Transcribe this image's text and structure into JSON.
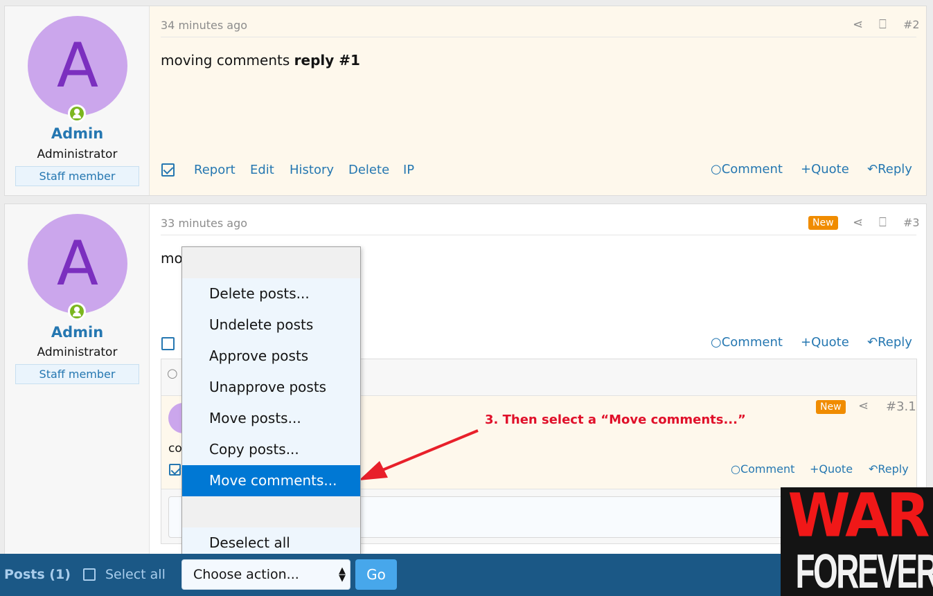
{
  "posts": [
    {
      "avatar_letter": "A",
      "username": "Admin",
      "user_title": "Administrator",
      "banner": "Staff member",
      "time": "34 minutes ago",
      "number": "#2",
      "content_plain": "moving comments ",
      "content_bold": "reply #1",
      "actions": [
        "Report",
        "Edit",
        "History",
        "Delete",
        "IP"
      ],
      "right_actions": [
        "Comment",
        "Quote",
        "Reply"
      ],
      "selected": true
    },
    {
      "avatar_letter": "A",
      "username": "Admin",
      "user_title": "Administrator",
      "banner": "Staff member",
      "time": "33 minutes ago",
      "badge": "New",
      "number": "#3",
      "content_partial": "mo",
      "right_actions": [
        "Comment",
        "Quote",
        "Reply"
      ],
      "selected": false,
      "comment": {
        "badge": "New",
        "number": "#3.1",
        "content_partial": "co",
        "avatar_letter": "A",
        "right_actions": [
          "Comment",
          "Quote",
          "Reply"
        ],
        "selected": true
      }
    }
  ],
  "dropdown": {
    "items": [
      "",
      "Delete posts...",
      "Undelete posts",
      "Approve posts",
      "Unapprove posts",
      "Move posts...",
      "Copy posts...",
      "Move comments...",
      "",
      "Deselect all"
    ],
    "selected": "Move comments..."
  },
  "annotation": "3. Then select a “Move comments...”",
  "bottom_bar": {
    "title": "Posts (1)",
    "select_all": "Select all",
    "action_select": "Choose action...",
    "go": "Go"
  },
  "logo": {
    "line1": "WAR",
    "line2": "FOREVER"
  },
  "colors": {
    "link": "#2577b1",
    "highlight": "#0078d4",
    "bar": "#1b5886",
    "badge": "#f08c00",
    "annotation": "#e0102a"
  }
}
